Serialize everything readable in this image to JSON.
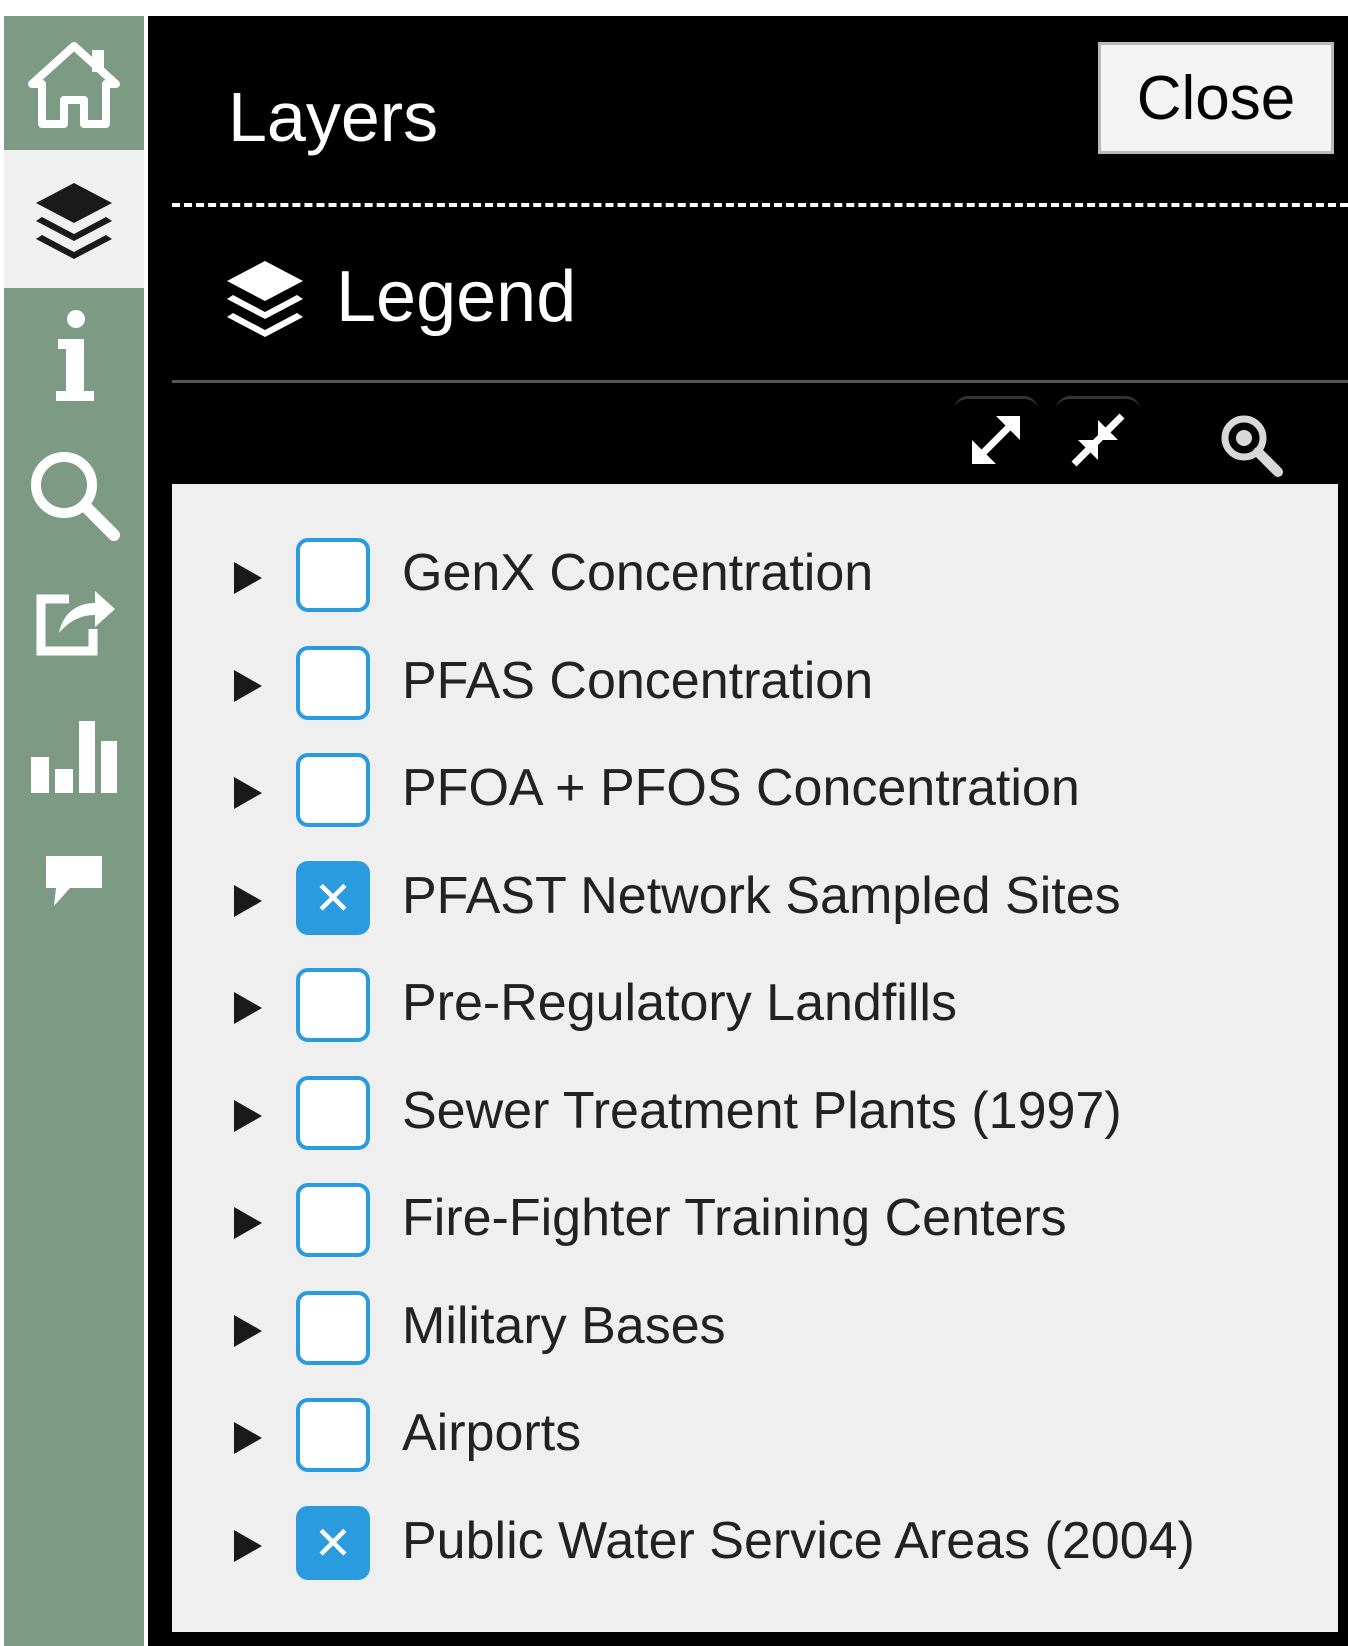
{
  "sidebar": {
    "items": [
      {
        "name": "home",
        "icon": "home-icon"
      },
      {
        "name": "layers",
        "icon": "layers-icon",
        "active": true
      },
      {
        "name": "info",
        "icon": "info-icon"
      },
      {
        "name": "search",
        "icon": "search-icon"
      },
      {
        "name": "share",
        "icon": "share-icon"
      },
      {
        "name": "chart",
        "icon": "bar-chart-icon"
      },
      {
        "name": "comment",
        "icon": "comment-icon"
      }
    ]
  },
  "panel": {
    "title": "Layers",
    "close_label": "Close",
    "legend_title": "Legend",
    "tools": [
      "expand-all-icon",
      "collapse-all-icon",
      "zoom-to-icon"
    ]
  },
  "layers": [
    {
      "label": "GenX Concentration",
      "checked": false
    },
    {
      "label": "PFAS Concentration",
      "checked": false
    },
    {
      "label": "PFOA + PFOS Concentration",
      "checked": false
    },
    {
      "label": "PFAST Network Sampled Sites",
      "checked": true
    },
    {
      "label": "Pre-Regulatory Landfills",
      "checked": false
    },
    {
      "label": "Sewer Treatment Plants (1997)",
      "checked": false
    },
    {
      "label": "Fire-Fighter Training Centers",
      "checked": false
    },
    {
      "label": "Military Bases",
      "checked": false
    },
    {
      "label": "Airports",
      "checked": false
    },
    {
      "label": "Public Water Service Areas (2004)",
      "checked": true
    }
  ],
  "colors": {
    "sidebar_bg": "#7d9b84",
    "panel_bg": "#000000",
    "list_bg": "#efefef",
    "checkbox_accent": "#2b9be0"
  },
  "checkbox_mark": "✕"
}
